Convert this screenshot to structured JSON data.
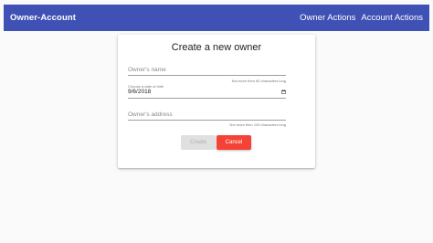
{
  "navbar": {
    "brand": "Owner-Account",
    "links": [
      "Owner Actions",
      "Account Actions"
    ],
    "color": "#3f51b5"
  },
  "form": {
    "title": "Create a new owner",
    "name_field": {
      "placeholder": "Owner's name",
      "hint": "Not more then 60 characters long"
    },
    "dob_field": {
      "label": "Choose a date of birth",
      "value": "9/6/2018",
      "icon": "calendar-icon"
    },
    "address_field": {
      "placeholder": "Owner's address",
      "hint": "Not more then 100 characters long"
    },
    "buttons": {
      "create_label": "Create",
      "cancel_label": "Cancel"
    },
    "colors": {
      "cancel": "#f44336",
      "create_disabled": "#e0e0e0"
    }
  }
}
